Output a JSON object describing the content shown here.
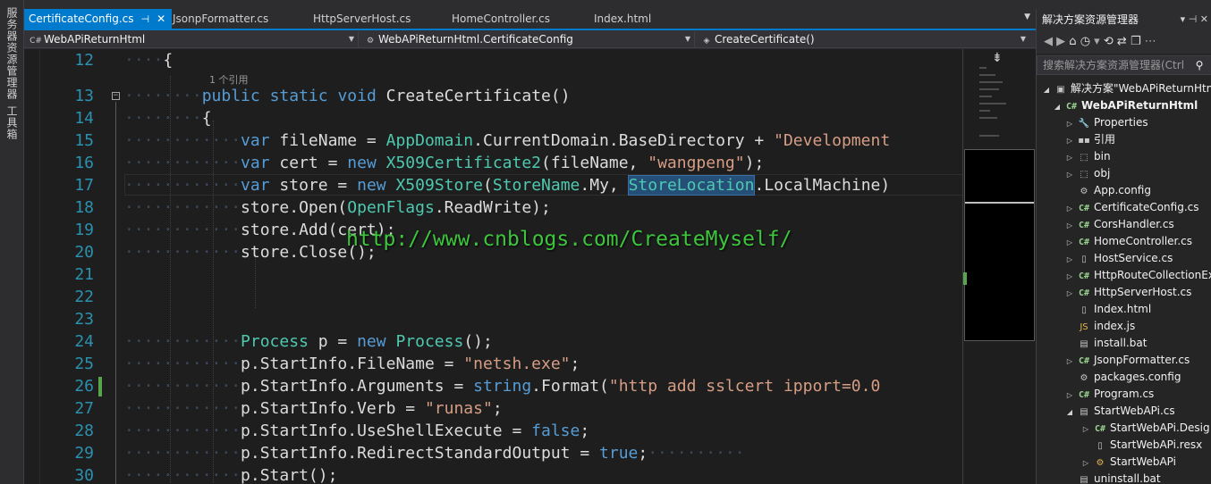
{
  "left_dock": {
    "tab1": "服务器资源管理器",
    "tab2": "工具箱"
  },
  "tabs": [
    {
      "label": "CertificateConfig.cs",
      "active": true
    },
    {
      "label": "JsonpFormatter.cs",
      "active": false
    },
    {
      "label": "HttpServerHost.cs",
      "active": false
    },
    {
      "label": "HomeController.cs",
      "active": false
    },
    {
      "label": "Index.html",
      "active": false
    }
  ],
  "navbar": {
    "project": "WebAPiReturnHtml",
    "class": "WebAPiReturnHtml.CertificateConfig",
    "member": "CreateCertificate()"
  },
  "editor": {
    "codelens": "1 个引用",
    "watermark": "http://www.cnblogs.com/CreateMyself/",
    "line_numbers": [
      "12",
      "13",
      "14",
      "15",
      "16",
      "17",
      "18",
      "19",
      "20",
      "21",
      "22",
      "23",
      "24",
      "25",
      "26",
      "27",
      "28",
      "29",
      "30"
    ]
  },
  "solution_explorer": {
    "title": "解决方案资源管理器",
    "search_placeholder": "搜索解决方案资源管理器(Ctrl",
    "items": [
      {
        "label": "解决方案\"WebAPiReturnHtml\"",
        "icon": "solution-icon"
      },
      {
        "label": "WebAPiReturnHtml",
        "icon": "csharp-project-icon"
      },
      {
        "label": "Properties",
        "icon": "wrench-icon"
      },
      {
        "label": "引用",
        "icon": "references-icon"
      },
      {
        "label": "bin",
        "icon": "folder-icon"
      },
      {
        "label": "obj",
        "icon": "folder-icon"
      },
      {
        "label": "App.config",
        "icon": "config-icon"
      },
      {
        "label": "CertificateConfig.cs",
        "icon": "csharp-file-icon"
      },
      {
        "label": "CorsHandler.cs",
        "icon": "csharp-file-icon"
      },
      {
        "label": "HomeController.cs",
        "icon": "csharp-file-icon"
      },
      {
        "label": "HostService.cs",
        "icon": "csharp-file-icon"
      },
      {
        "label": "HttpRouteCollectionEx",
        "icon": "csharp-file-icon"
      },
      {
        "label": "HttpServerHost.cs",
        "icon": "csharp-file-icon"
      },
      {
        "label": "Index.html",
        "icon": "html-file-icon"
      },
      {
        "label": "index.js",
        "icon": "js-file-icon"
      },
      {
        "label": "install.bat",
        "icon": "bat-file-icon"
      },
      {
        "label": "JsonpFormatter.cs",
        "icon": "csharp-file-icon"
      },
      {
        "label": "packages.config",
        "icon": "config-icon"
      },
      {
        "label": "Program.cs",
        "icon": "csharp-file-icon"
      },
      {
        "label": "StartWebAPi.cs",
        "icon": "form-icon"
      },
      {
        "label": "StartWebAPi.Desig",
        "icon": "csharp-file-icon"
      },
      {
        "label": "StartWebAPi.resx",
        "icon": "resx-icon"
      },
      {
        "label": "StartWebAPi",
        "icon": "class-icon"
      },
      {
        "label": "uninstall.bat",
        "icon": "bat-file-icon"
      }
    ]
  }
}
